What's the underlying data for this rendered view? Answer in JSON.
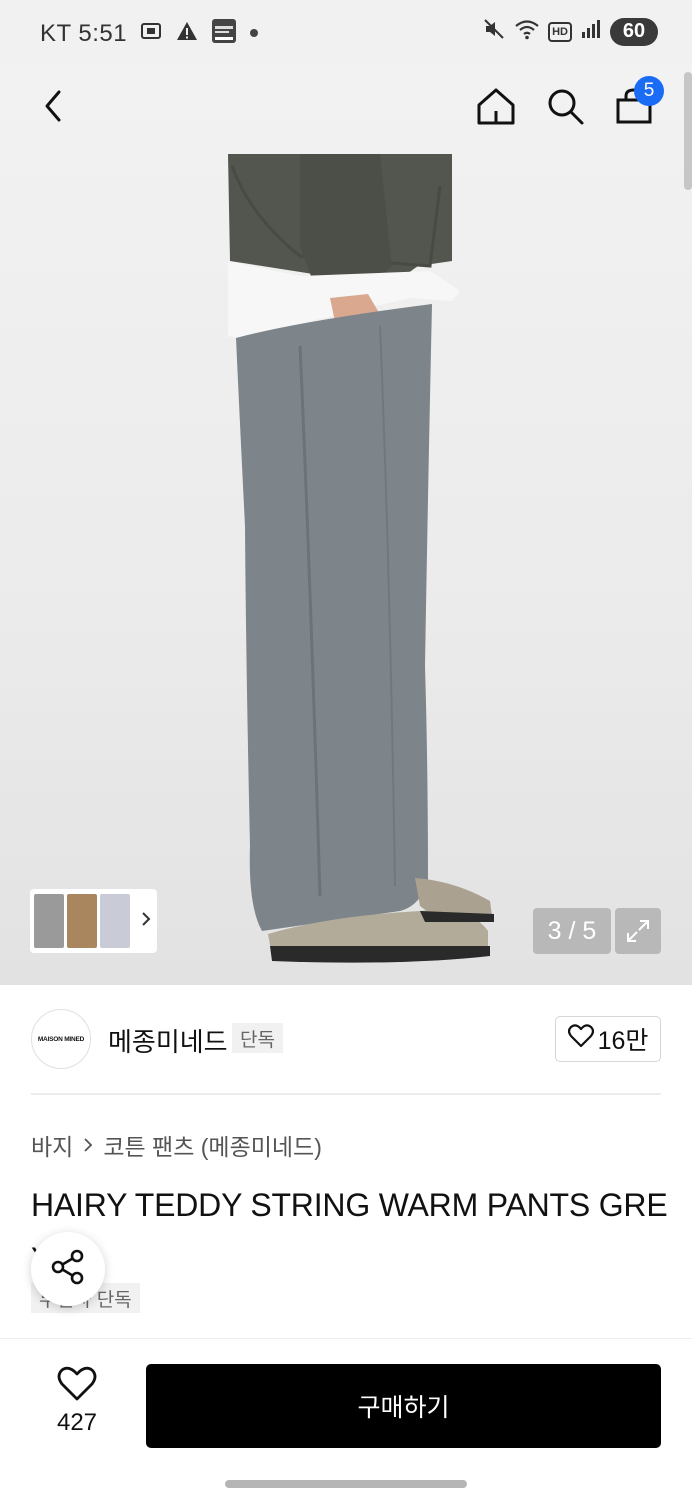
{
  "status_bar": {
    "carrier_time": "KT 5:51",
    "battery": "60",
    "hd_label": "HD",
    "icons": [
      "screenshot-icon",
      "warning-icon",
      "notification-app-icon",
      "dot-icon",
      "mute-icon",
      "wifi-icon",
      "hd-voice-icon",
      "signal-icon",
      "battery-icon"
    ]
  },
  "header": {
    "icons": [
      "back-arrow-icon",
      "home-icon",
      "search-icon",
      "shopping-bag-icon"
    ],
    "cart_count": "5"
  },
  "gallery": {
    "counter": "3 / 5",
    "thumb_colors": [
      "#9a9a9a",
      "#5c5c5c",
      "#a9865e",
      "#c9ccd6"
    ]
  },
  "brand": {
    "logo_text": "MAISON MINED",
    "name": "메종미네드",
    "badge": "단독",
    "like_count": "16만"
  },
  "breadcrumb": {
    "category": "바지",
    "subcategory": "코튼 팬츠 (메종미네드)"
  },
  "product": {
    "title": "HAIRY TEDDY STRING WARM PANTS GREY",
    "tag": "무신사 단독"
  },
  "bottom_bar": {
    "like_count": "427",
    "buy_label": "구매하기"
  },
  "colors": {
    "accent": "#1a6cf5",
    "buy_button": "#000000",
    "pants_grey": "#7d858a",
    "sweatshirt": "#52564f"
  }
}
